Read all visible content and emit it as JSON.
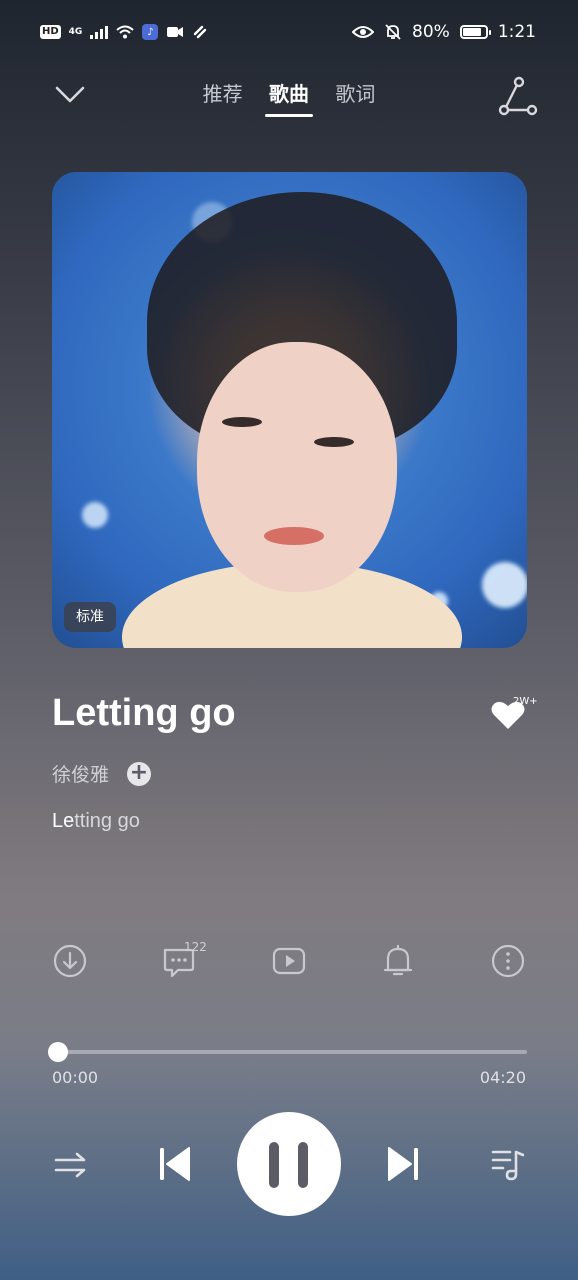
{
  "status": {
    "hd": "HD",
    "network": "4G",
    "battery_percent": 80,
    "battery_label": "80%",
    "time": "1:21"
  },
  "header": {
    "tabs": [
      {
        "label": "推荐",
        "active": false
      },
      {
        "label": "歌曲",
        "active": true
      },
      {
        "label": "歌词",
        "active": false
      }
    ]
  },
  "album": {
    "quality_label": "标准"
  },
  "song": {
    "title": "Letting go",
    "artist": "徐俊雅",
    "follow_label": "+",
    "like_count": "2W+",
    "lyric_highlight": "Le",
    "lyric_rest": "tting go"
  },
  "actions": {
    "comment_count": "122",
    "icons": [
      "download-icon",
      "comment-icon",
      "video-icon",
      "bell-icon",
      "more-icon"
    ]
  },
  "progress": {
    "current": "00:00",
    "total": "04:20",
    "fraction": 0.0
  },
  "controls": {
    "icons": [
      "repeat-icon",
      "previous-icon",
      "pause-icon",
      "next-icon",
      "playlist-icon"
    ]
  },
  "colors": {
    "accent": "#ffffff",
    "icon_muted": "#c8c8d0"
  }
}
